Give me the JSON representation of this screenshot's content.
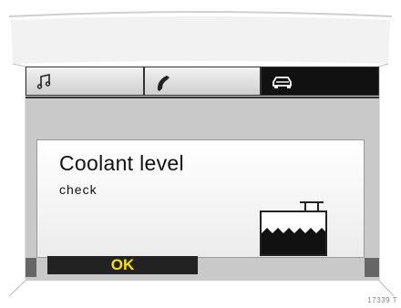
{
  "tabs": [
    {
      "icon": "music-note-icon",
      "active": false
    },
    {
      "icon": "phone-icon",
      "active": false
    },
    {
      "icon": "car-icon",
      "active": true
    }
  ],
  "message": {
    "title": "Coolant level",
    "subtitle": "check",
    "icon": "coolant-reservoir-icon"
  },
  "ok_button": {
    "label": "OK"
  },
  "reference": "17339 T",
  "colors": {
    "ok_label": "#f5e400",
    "active_tab": "#111111"
  }
}
